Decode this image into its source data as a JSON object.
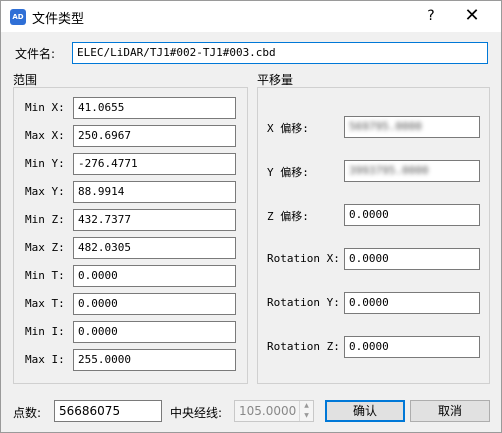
{
  "window": {
    "icon_text": "AD",
    "title": "文件类型",
    "help_glyph": "?",
    "close_glyph": "✕"
  },
  "file": {
    "label": "文件名:",
    "value": "ELEC/LiDAR/TJ1#002-TJ1#003.cbd"
  },
  "range": {
    "title": "范围",
    "fields": [
      {
        "label": "Min X:",
        "value": "41.0655"
      },
      {
        "label": "Max X:",
        "value": "250.6967"
      },
      {
        "label": "Min Y:",
        "value": "-276.4771"
      },
      {
        "label": "Max Y:",
        "value": "88.9914"
      },
      {
        "label": "Min Z:",
        "value": "432.7377"
      },
      {
        "label": "Max Z:",
        "value": "482.0305"
      },
      {
        "label": "Min T:",
        "value": "0.0000"
      },
      {
        "label": "Max T:",
        "value": "0.0000"
      },
      {
        "label": "Min I:",
        "value": "0.0000"
      },
      {
        "label": "Max I:",
        "value": "255.0000"
      }
    ]
  },
  "offset": {
    "title": "平移量",
    "fields": [
      {
        "label": "X 偏移:",
        "value": "569795.0000"
      },
      {
        "label": "Y 偏移:",
        "value": "3993795.0000"
      },
      {
        "label": "Z 偏移:",
        "value": "0.0000"
      },
      {
        "label": "Rotation X:",
        "value": "0.0000"
      },
      {
        "label": "Rotation Y:",
        "value": "0.0000"
      },
      {
        "label": "Rotation Z:",
        "value": "0.0000"
      }
    ]
  },
  "footer": {
    "points_label": "点数:",
    "points_value": "56686075",
    "meridian_label": "中央经线:",
    "meridian_value": "105.0000",
    "ok_label": "确认",
    "cancel_label": "取消"
  }
}
